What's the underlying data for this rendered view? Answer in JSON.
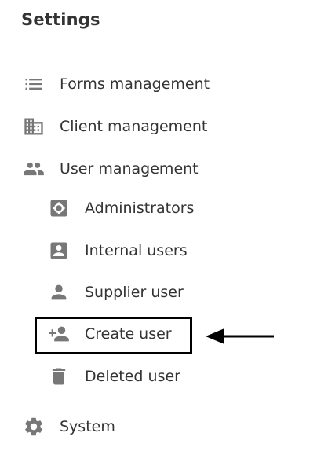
{
  "header": {
    "title": "Settings"
  },
  "menu": {
    "forms": {
      "label": "Forms management",
      "icon": "list-icon"
    },
    "clients": {
      "label": "Client management",
      "icon": "building-icon"
    },
    "users": {
      "label": "User management",
      "icon": "people-icon",
      "children": {
        "administrators": {
          "label": "Administrators",
          "icon": "admin-gear-icon"
        },
        "internal": {
          "label": "Internal users",
          "icon": "portrait-icon"
        },
        "supplier": {
          "label": "Supplier user",
          "icon": "person-icon"
        },
        "create": {
          "label": "Create user",
          "icon": "person-add-icon",
          "highlighted": true
        },
        "deleted": {
          "label": "Deleted user",
          "icon": "trash-icon"
        }
      }
    },
    "system": {
      "label": "System",
      "icon": "gear-icon"
    }
  },
  "colors": {
    "icon": "#777777",
    "text": "#333333",
    "annotation": "#000000"
  }
}
